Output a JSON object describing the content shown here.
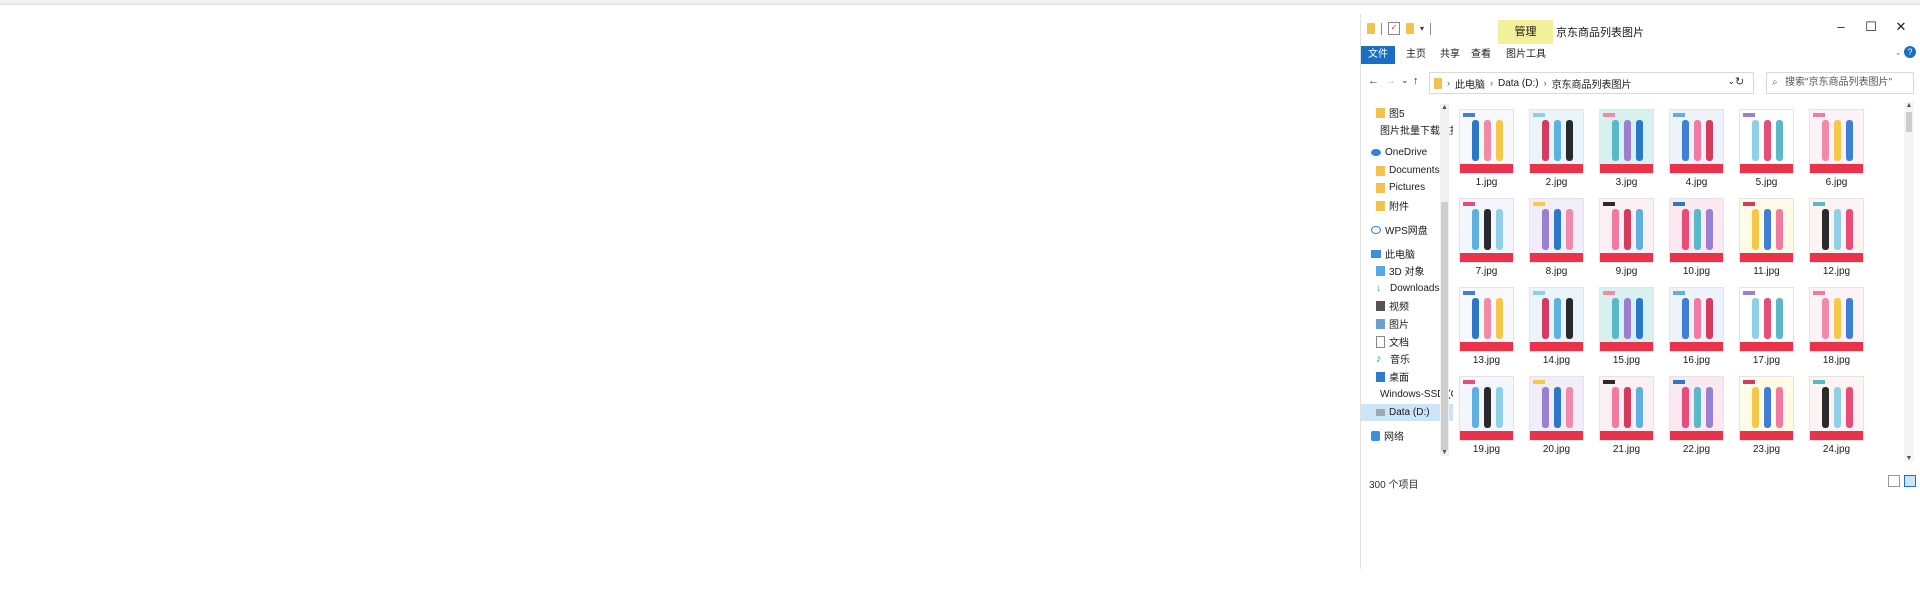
{
  "window": {
    "title": "京东商品列表图片",
    "manage_tab": "管理",
    "minimize": "–",
    "maximize": "☐",
    "close": "✕"
  },
  "ribbon": {
    "file": "文件",
    "home": "主页",
    "share": "共享",
    "view": "查看",
    "picture_tools": "图片工具"
  },
  "nav": {
    "back": "←",
    "forward": "→",
    "recent": "⌄",
    "up": "↑",
    "refresh": "↻"
  },
  "address": {
    "parts": [
      "此电脑",
      "Data (D:)",
      "京东商品列表图片"
    ]
  },
  "search": {
    "placeholder": "搜索\"京东商品列表图片\""
  },
  "navpane": {
    "items": [
      {
        "label": "图5",
        "icon": "folder-icon"
      },
      {
        "label": "图片批量下载数据",
        "icon": "folder-icon"
      },
      {
        "label": "OneDrive",
        "icon": "onedrive-cloud-icon"
      },
      {
        "label": "Documents",
        "icon": "folder-icon"
      },
      {
        "label": "Pictures",
        "icon": "folder-icon"
      },
      {
        "label": "附件",
        "icon": "folder-icon"
      },
      {
        "label": "WPS网盘",
        "icon": "wps-cloud-icon"
      },
      {
        "label": "此电脑",
        "icon": "computer-icon"
      },
      {
        "label": "3D 对象",
        "icon": "3d-objects-icon"
      },
      {
        "label": "Downloads",
        "icon": "download-icon"
      },
      {
        "label": "视频",
        "icon": "video-icon"
      },
      {
        "label": "图片",
        "icon": "pictures-icon"
      },
      {
        "label": "文档",
        "icon": "documents-icon"
      },
      {
        "label": "音乐",
        "icon": "music-icon"
      },
      {
        "label": "桌面",
        "icon": "desktop-icon"
      },
      {
        "label": "Windows-SSD (C:)",
        "icon": "drive-icon"
      },
      {
        "label": "Data (D:)",
        "icon": "drive-icon",
        "selected": true
      },
      {
        "label": "网络",
        "icon": "network-icon"
      }
    ]
  },
  "files": [
    "1.jpg",
    "2.jpg",
    "3.jpg",
    "4.jpg",
    "5.jpg",
    "6.jpg",
    "7.jpg",
    "8.jpg",
    "9.jpg",
    "10.jpg",
    "11.jpg",
    "12.jpg",
    "13.jpg",
    "14.jpg",
    "15.jpg",
    "16.jpg",
    "17.jpg",
    "18.jpg",
    "19.jpg",
    "20.jpg",
    "21.jpg",
    "22.jpg",
    "23.jpg",
    "24.jpg"
  ],
  "status": {
    "count": "300 个项目"
  },
  "colors": {
    "accent": "#1a6fc4",
    "manage_tab_bg": "#f4ef9b",
    "selected_bg": "#cce4f7",
    "thumb_band": "#e8334a"
  }
}
